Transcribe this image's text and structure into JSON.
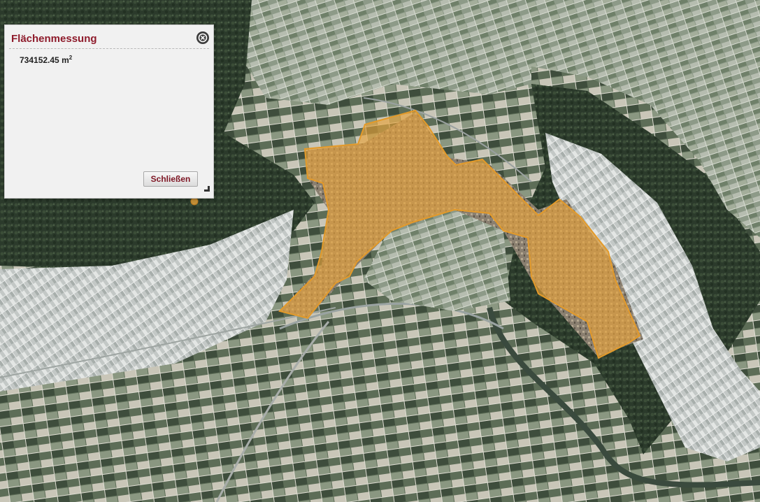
{
  "panel": {
    "title": "Flächenmessung",
    "measurement_value": "734152.45",
    "measurement_unit": "m",
    "measurement_unit_exponent": "2",
    "close_button_label": "Schließen",
    "close_icon": "close-circle-icon"
  },
  "map": {
    "type": "aerial imagery",
    "measured_area_fill": "#e8a33a",
    "measured_area_stroke": "#e39a2a"
  },
  "colors": {
    "title_color": "#8e1b2b",
    "button_text": "#7e1624",
    "panel_background": "#f1f1f1"
  }
}
